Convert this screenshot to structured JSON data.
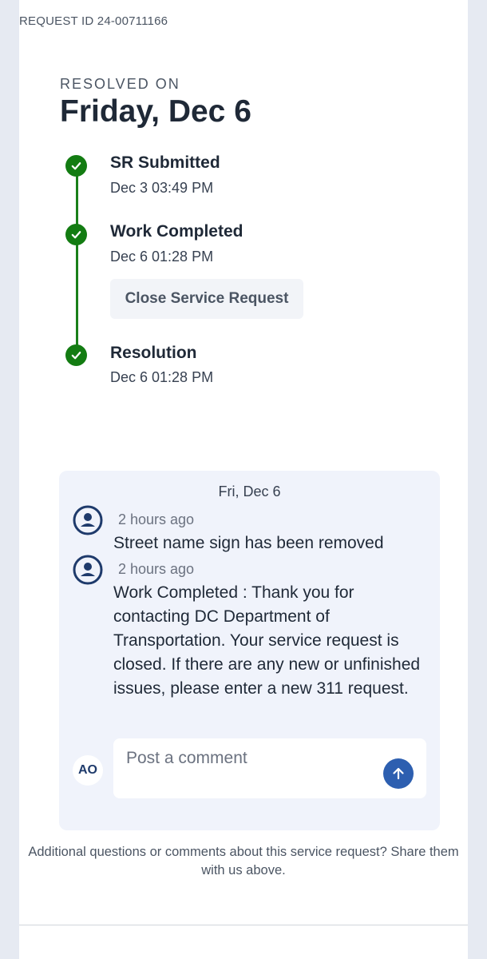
{
  "request_id": "REQUEST ID 24-00711166",
  "status": {
    "label": "RESOLVED ON",
    "date": "Friday, Dec 6"
  },
  "timeline": [
    {
      "title": "SR Submitted",
      "time": "Dec 3 03:49 PM",
      "icon": "check-circle-icon"
    },
    {
      "title": "Work Completed",
      "time": "Dec 6 01:28 PM",
      "icon": "check-circle-icon"
    },
    {
      "title": "Resolution",
      "time": "Dec 6 01:28 PM",
      "icon": "check-circle-icon"
    }
  ],
  "actions": {
    "close_label": "Close Service Request"
  },
  "comments": {
    "date_header": "Fri, Dec 6",
    "items": [
      {
        "time": "2 hours ago",
        "text": "Street name sign has been removed",
        "avatar": "user-avatar-icon"
      },
      {
        "time": "2 hours ago",
        "text": "Work Completed : Thank you for contacting DC Department of Transportation. Your service request is closed. If there are any new or unfinished issues, please enter a new 311 request.",
        "avatar": "user-avatar-icon"
      }
    ],
    "user_initials": "AO",
    "input_placeholder": "Post a comment",
    "input_value": "",
    "send_icon": "arrow-up-icon"
  },
  "footer": {
    "note": "Additional questions or comments about this service request? Share them with us above."
  },
  "colors": {
    "success": "#137c12",
    "accent": "#2d5fb0",
    "avatar": "#1e3a6b",
    "panel": "#f0f3fb"
  }
}
